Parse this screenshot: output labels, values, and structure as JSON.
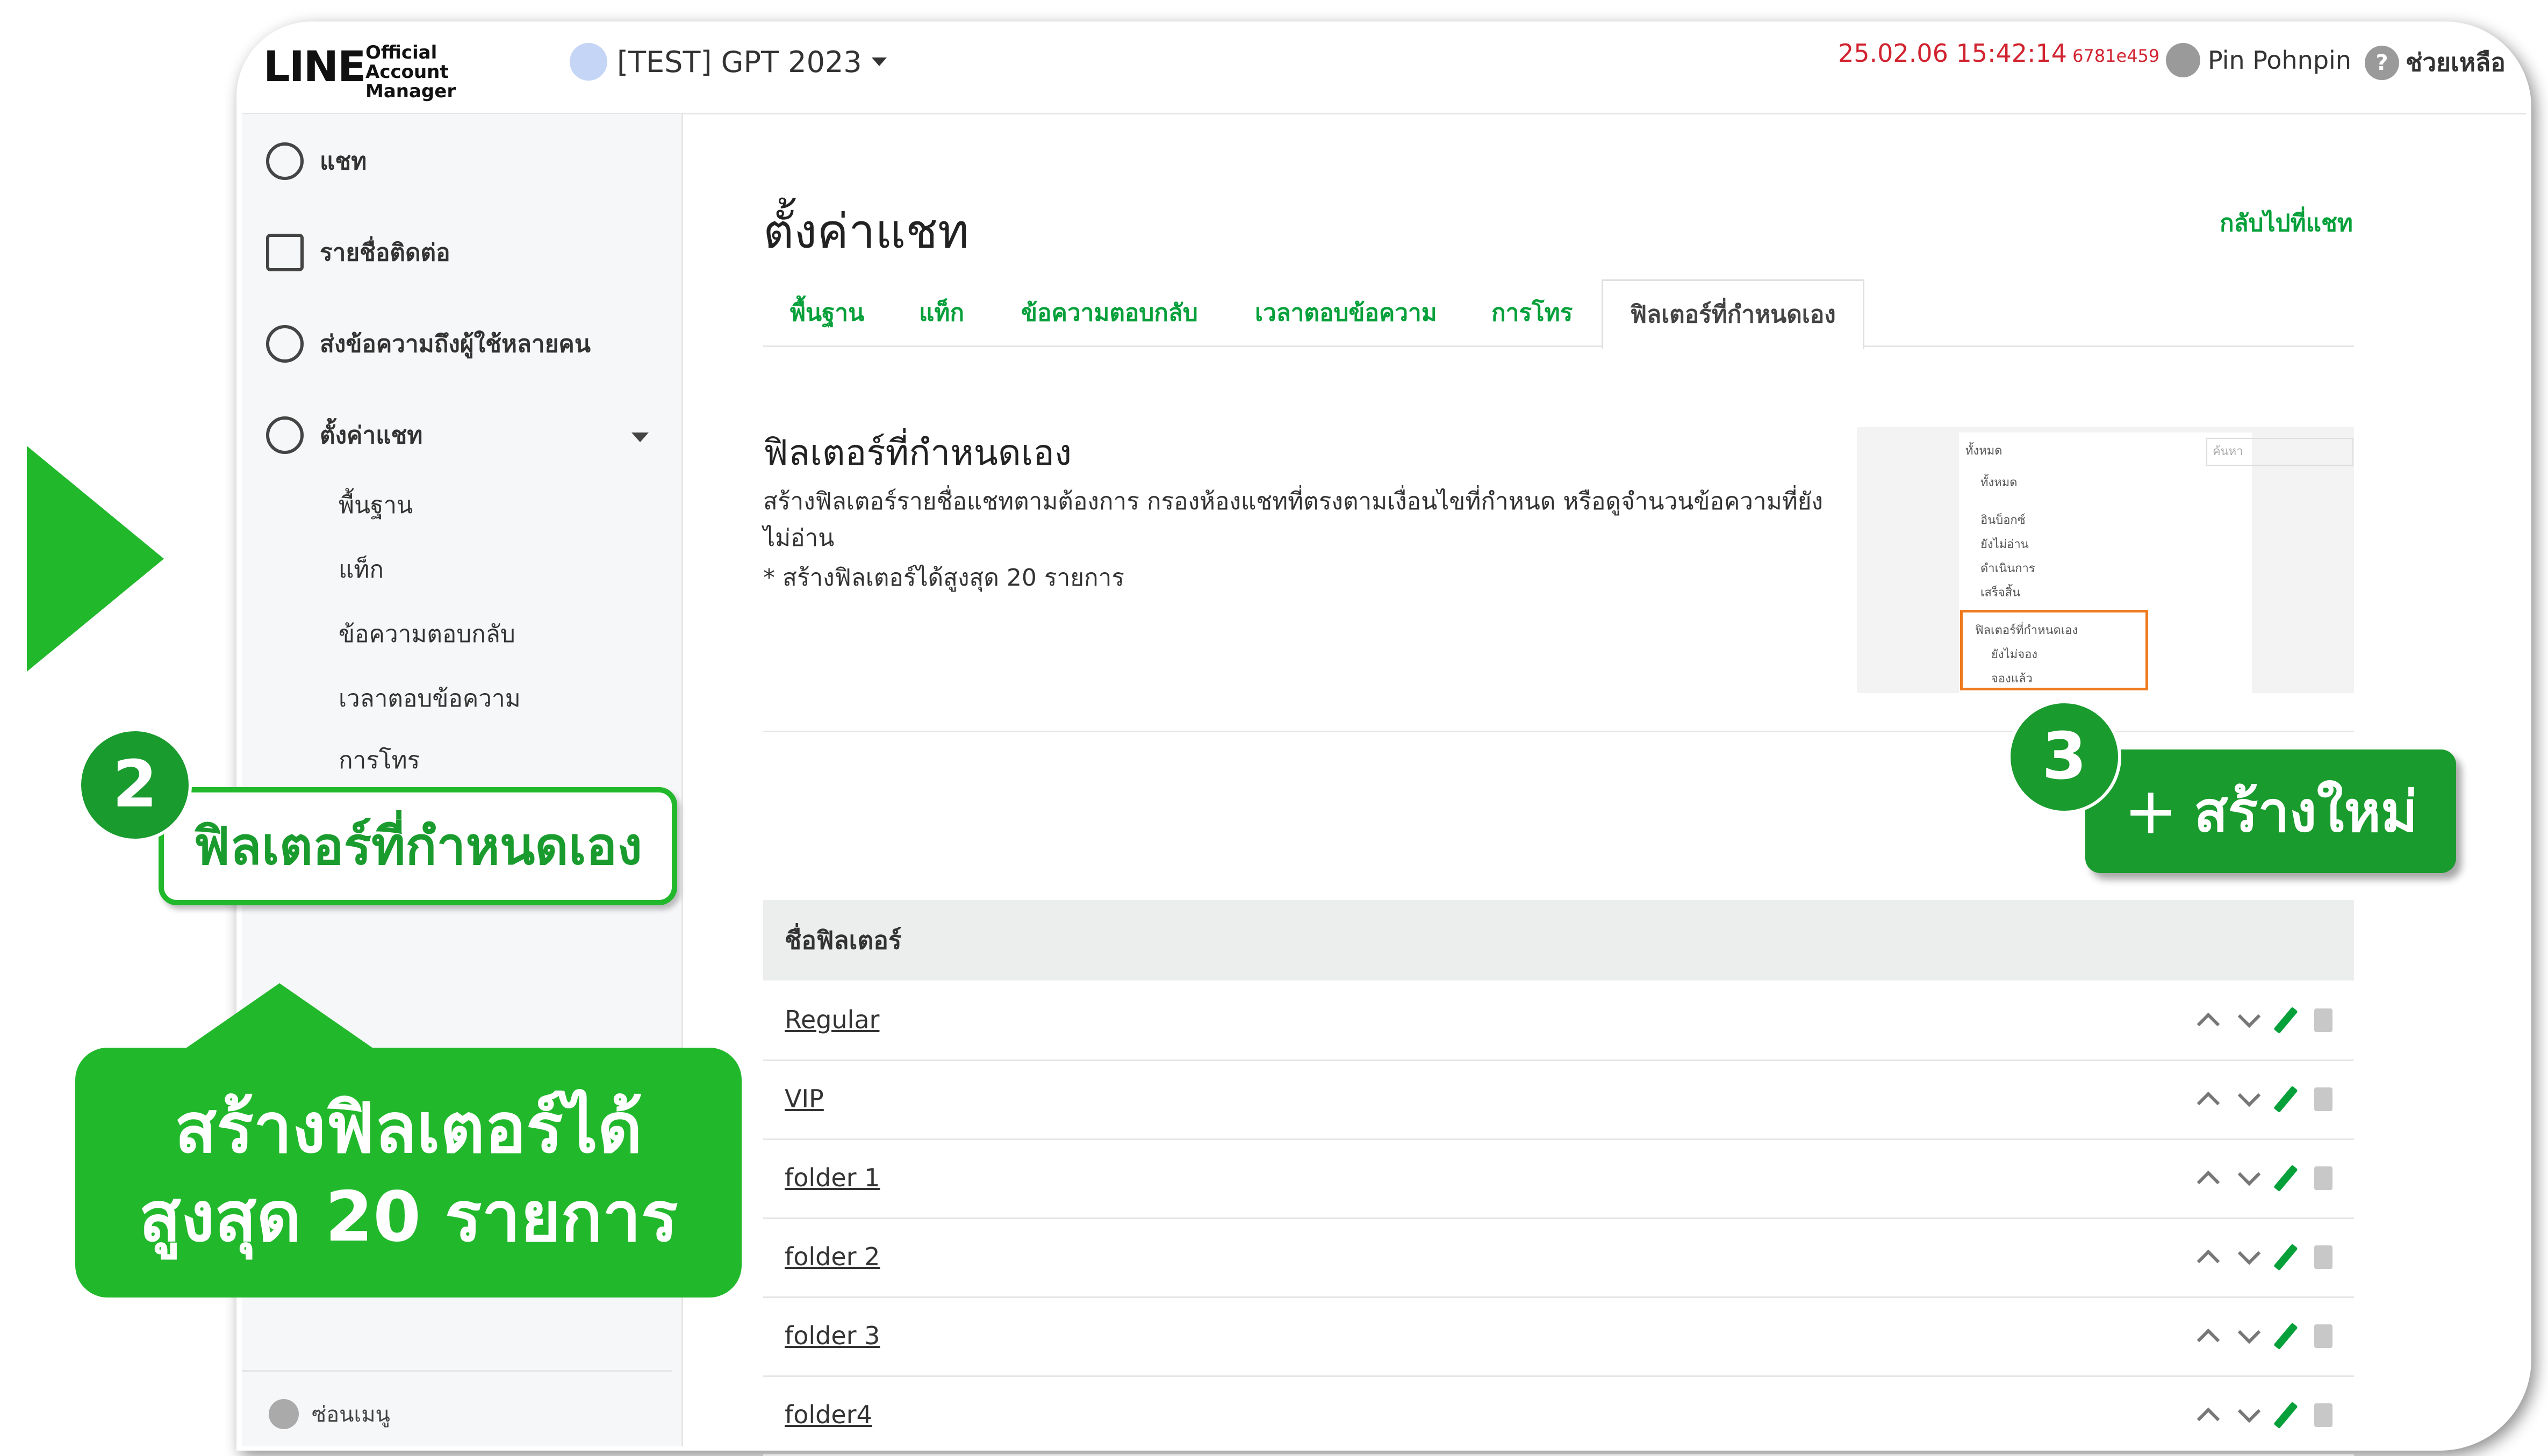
{
  "header": {
    "logo": "LINE",
    "logo_sub": [
      "Official Account",
      "Manager"
    ],
    "account_name": "[TEST] GPT 2023",
    "timestamp": "25.02.06 15:42:14",
    "build_id": "6781e459",
    "user_name": "Pin Pohnpin",
    "help_label": "ช่วยเหลือ"
  },
  "sidebar": {
    "items": [
      {
        "label": "แชท",
        "icon": "chat-icon"
      },
      {
        "label": "รายชื่อติดต่อ",
        "icon": "contacts-icon"
      },
      {
        "label": "ส่งข้อความถึงผู้ใช้หลายคน",
        "icon": "broadcast-icon"
      },
      {
        "label": "ตั้งค่าแชท",
        "icon": "gear-icon"
      }
    ],
    "sub_items": [
      "พื้นฐาน",
      "แท็ก",
      "ข้อความตอบกลับ",
      "เวลาตอบข้อความ",
      "การโทร"
    ],
    "collapse_label": "ซ่อนเมนู"
  },
  "main": {
    "title": "ตั้งค่าแชท",
    "back_link": "กลับไปที่แชท",
    "tabs": [
      "พื้นฐาน",
      "แท็ก",
      "ข้อความตอบกลับ",
      "เวลาตอบข้อความ",
      "การโทร",
      "ฟิลเตอร์ที่กำหนดเอง"
    ],
    "active_tab": "ฟิลเตอร์ที่กำหนดเอง",
    "section_title": "ฟิลเตอร์ที่กำหนดเอง",
    "section_desc": "สร้างฟิลเตอร์รายชื่อแชทตามต้องการ กรองห้องแชทที่ตรงตามเงื่อนไขที่กำหนด หรือดูจำนวนข้อความที่ยังไม่อ่าน",
    "section_note": "* สร้างฟิลเตอร์ได้สูงสุด 20 รายการ",
    "preview": {
      "dropdown": "ทั้งหมด",
      "search_placeholder": "ค้นหา",
      "options": [
        "ทั้งหมด",
        "อินบ็อกซ์",
        "ยังไม่อ่าน",
        "ดำเนินการ",
        "เสร็จสิ้น"
      ],
      "filter_group": "ฟิลเตอร์ที่กำหนดเอง",
      "filter_options": [
        "ยังไม่จอง",
        "จองแล้ว"
      ]
    },
    "create_button": "สร้างใหม่",
    "table_header": "ชื่อฟิลเตอร์",
    "rows": [
      "Regular",
      "VIP",
      "folder 1",
      "folder 2",
      "folder 3",
      "folder4"
    ]
  },
  "overlay": {
    "badge2": "2",
    "badge3": "3",
    "callout_label": "ฟิลเตอร์ที่กำหนดเอง",
    "tip_line1": "สร้างฟิลเตอร์ได้",
    "tip_line2": "สูงสุด 20 รายการ"
  },
  "colors": {
    "accent": "#06a03a",
    "overlay_green": "#22b82c",
    "timestamp": "#d1232f"
  }
}
